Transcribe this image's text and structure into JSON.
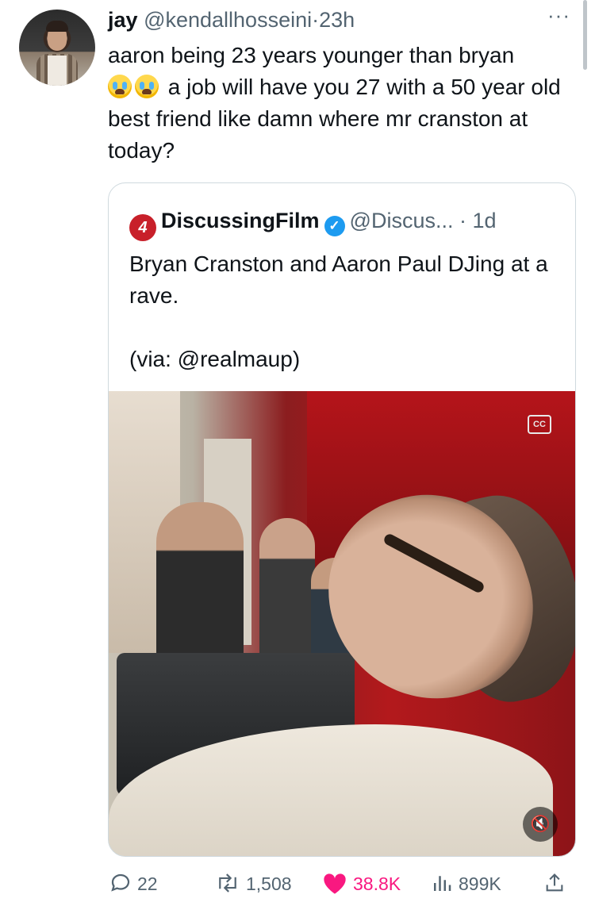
{
  "tweet": {
    "author_name": "jay",
    "author_handle": "@kendallhosseini",
    "separator": "·",
    "time": "23h",
    "more_label": "···",
    "text_part1": "aaron being 23 years younger than bryan",
    "text_part2": "a job will have you 27 with a 50 year old best friend like damn where mr cranston at today?"
  },
  "quoted": {
    "logo_text": "4",
    "name": "DiscussingFilm",
    "handle": "@Discus...",
    "separator": "·",
    "time": "1d",
    "text": "Bryan Cranston and Aaron Paul DJing at a rave.\n\n(via: @realmaup)",
    "media": {
      "cc_label": "CC"
    }
  },
  "actions": {
    "replies": "22",
    "reposts": "1,508",
    "likes": "38.8K",
    "views": "899K"
  },
  "colors": {
    "like": "#f91880",
    "verified": "#1d9bf0",
    "secondary_text": "#536471",
    "brand_logo": "#c8202a"
  }
}
